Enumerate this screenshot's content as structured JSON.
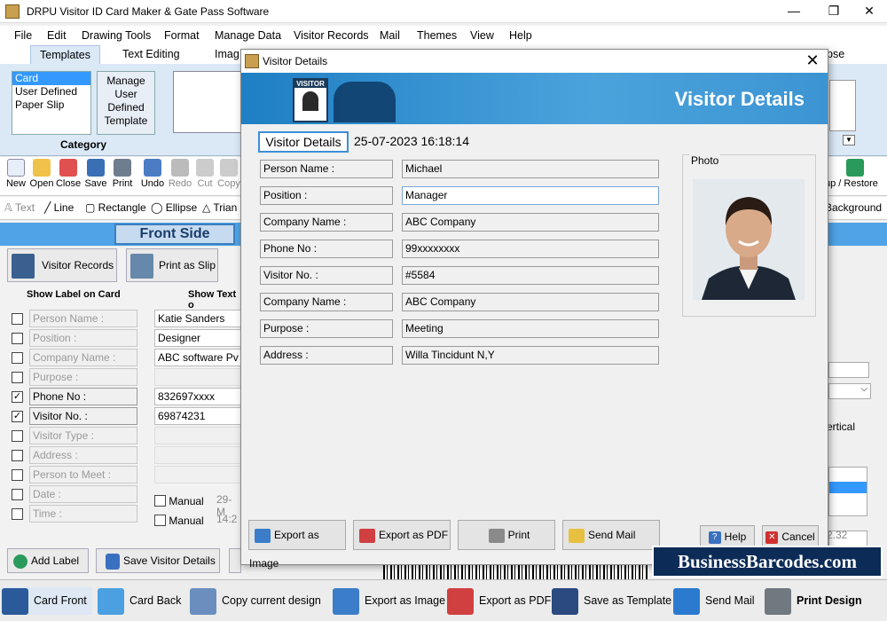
{
  "app": {
    "title": "DRPU Visitor ID Card Maker & Gate Pass Software"
  },
  "menu": [
    "File",
    "Edit",
    "Drawing Tools",
    "Format",
    "Manage Data",
    "Visitor Records",
    "Mail",
    "Themes",
    "View",
    "Help"
  ],
  "ribbon_tabs": [
    "Templates",
    "Text Editing",
    "Imag"
  ],
  "ribbon_tab_right": "pse",
  "category": {
    "items": [
      "Card Templates",
      "User Defined",
      "Paper Slip"
    ],
    "manage_btn": "Manage User Defined Template",
    "label": "Category"
  },
  "toolbar": [
    "New",
    "Open",
    "Close",
    "Save",
    "Print",
    "Undo",
    "Redo",
    "Cut",
    "Copy"
  ],
  "toolbar_right": "up / Restore",
  "drawbar": [
    "Text",
    "Line",
    "Rectangle",
    "Ellipse",
    "Trian"
  ],
  "drawbar_right": "Background",
  "front_side": "Front Side",
  "left": {
    "visitor_records": "Visitor Records",
    "print_slip": "Print as Slip",
    "show_label": "Show Label on Card",
    "show_text": "Show Text o",
    "rows": [
      {
        "label": "Person Name :",
        "value": "Katie Sanders",
        "checked": false,
        "on": false
      },
      {
        "label": "Position :",
        "value": "Designer",
        "checked": false,
        "on": false
      },
      {
        "label": "Company Name :",
        "value": "ABC software Pv",
        "checked": false,
        "on": false
      },
      {
        "label": "Purpose :",
        "value": "",
        "checked": false,
        "on": false
      },
      {
        "label": "Phone No :",
        "value": "832697xxxx",
        "checked": true,
        "on": true
      },
      {
        "label": "Visitor No. :",
        "value": "69874231",
        "checked": true,
        "on": true
      },
      {
        "label": "Visitor Type :",
        "value": "",
        "checked": false,
        "on": false
      },
      {
        "label": "Address :",
        "value": "",
        "checked": false,
        "on": false
      },
      {
        "label": "Person to Meet :",
        "value": "",
        "checked": false,
        "on": false
      },
      {
        "label": "Date :",
        "value": "",
        "checked": false,
        "on": false
      },
      {
        "label": "Time :",
        "value": "",
        "checked": false,
        "on": false
      }
    ],
    "manual": "Manual",
    "manual_date": "29-M",
    "manual_time": "14:2",
    "add_label": "Add Label",
    "save_visitor": "Save Visitor Details",
    "clear": "Clear Details"
  },
  "right": {
    "vertical": "ertical",
    "num": "2.32"
  },
  "dialog": {
    "title": "Visitor Details",
    "banner": "Visitor Details",
    "label_box": "Visitor Details",
    "datetime": "25-07-2023 16:18:14",
    "fields": [
      {
        "label": "Person Name :",
        "value": "Michael"
      },
      {
        "label": "Position :",
        "value": "Manager"
      },
      {
        "label": "Company Name :",
        "value": "ABC Company"
      },
      {
        "label": "Phone No :",
        "value": "99xxxxxxxx"
      },
      {
        "label": "Visitor No. :",
        "value": "#5584"
      },
      {
        "label": "Company Name :",
        "value": "ABC Company"
      },
      {
        "label": "Purpose :",
        "value": "Meeting"
      },
      {
        "label": "Address :",
        "value": "Willa Tincidunt N,Y"
      }
    ],
    "photo_label": "Photo",
    "buttons": {
      "export_image": "Export as Image",
      "export_pdf": "Export as PDF",
      "print": "Print",
      "send_mail": "Send Mail",
      "help": "Help",
      "cancel": "Cancel"
    }
  },
  "bottom": [
    "Card Front",
    "Card Back",
    "Copy current design",
    "Export as Image",
    "Export as PDF",
    "Save as Template",
    "Send Mail",
    "Print Design"
  ],
  "watermark": "BusinessBarcodes.com",
  "colors": {
    "accent": "#4fa3e6",
    "banner": "#1f7fc4",
    "selection": "#3399ff"
  }
}
